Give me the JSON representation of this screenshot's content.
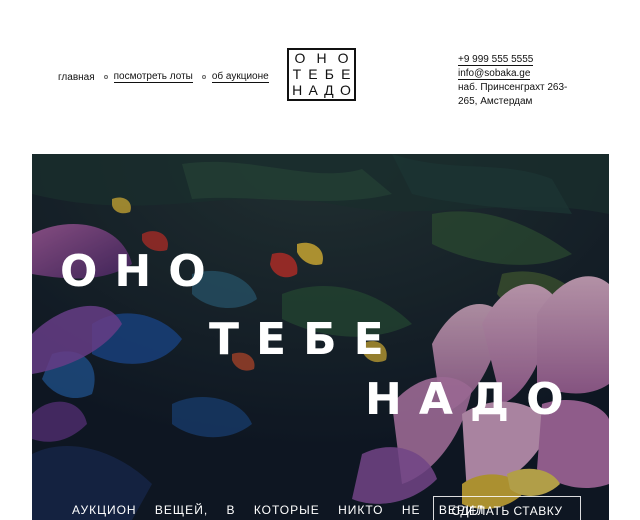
{
  "nav": {
    "home": "главная",
    "lots": "посмотреть лоты",
    "about": "об аукционе"
  },
  "logo": {
    "row1": [
      "О",
      "Н",
      "О"
    ],
    "row2": [
      "Т",
      "Е",
      "Б",
      "Е"
    ],
    "row3": [
      "Н",
      "А",
      "Д",
      "О"
    ]
  },
  "contact": {
    "phone": "+9 999 555 5555",
    "email": "info@sobaka.ge",
    "address": "наб. Принсенграхт 263-265, Амстердам"
  },
  "hero": {
    "word1": "ОНО",
    "word2": "ТЕБЕ",
    "word3": "НАДО",
    "tagline": "АУКЦИОН ВЕЩЕЙ, В КОТОРЫЕ НИКТО НЕ ВЕРИЛ",
    "bid_button": "СДЕЛАТЬ СТАВКУ"
  },
  "colors": {
    "hero_base": "#142233",
    "petal_pink": "#e8a6c8",
    "petal_purple": "#7a4fa0",
    "accent_yellow": "#e9c23a",
    "accent_red": "#c8352c"
  }
}
